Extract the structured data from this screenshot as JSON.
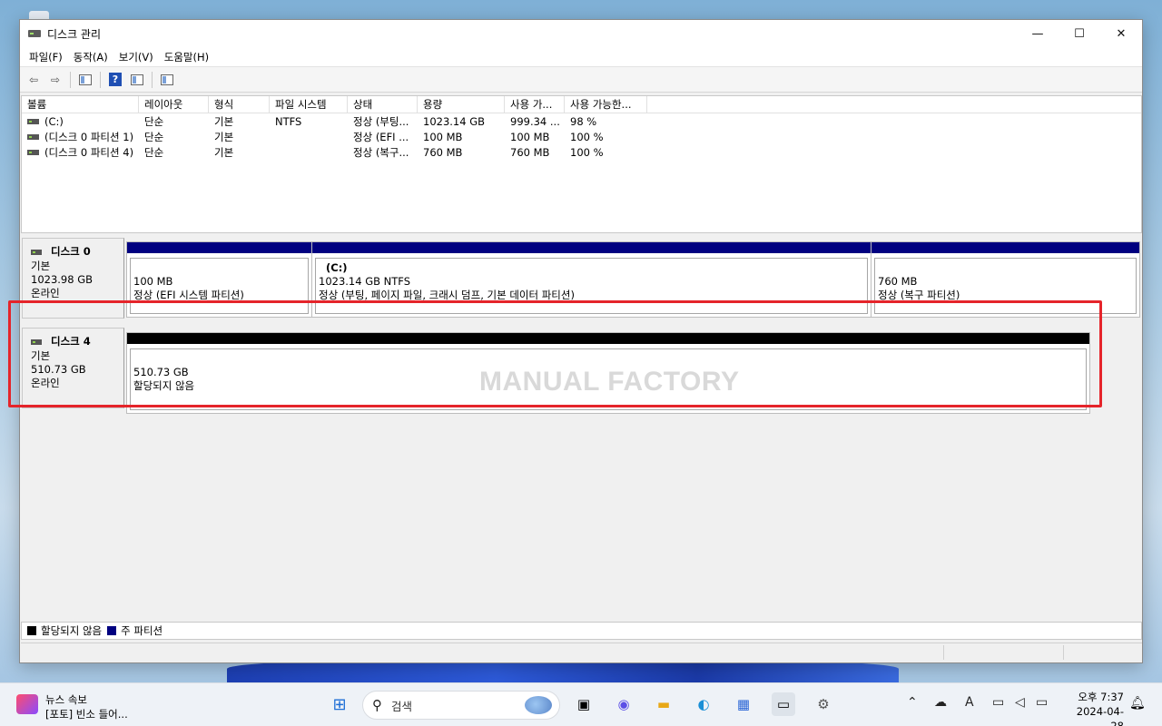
{
  "window": {
    "title": "디스크 관리",
    "controls": {
      "minimize": "—",
      "maximize": "☐",
      "close": "✕"
    }
  },
  "menu": [
    "파일(F)",
    "동작(A)",
    "보기(V)",
    "도움말(H)"
  ],
  "volume_list": {
    "columns": [
      "볼륨",
      "레이아웃",
      "형식",
      "파일 시스템",
      "상태",
      "용량",
      "사용 가...",
      "사용 가능한..."
    ],
    "rows": [
      [
        "(C:)",
        "단순",
        "기본",
        "NTFS",
        "정상 (부팅...",
        "1023.14 GB",
        "999.34 ...",
        "98 %"
      ],
      [
        "(디스크 0 파티션 1)",
        "단순",
        "기본",
        "",
        "정상 (EFI ...",
        "100 MB",
        "100 MB",
        "100 %"
      ],
      [
        "(디스크 0 파티션 4)",
        "단순",
        "기본",
        "",
        "정상 (복구...",
        "760 MB",
        "760 MB",
        "100 %"
      ]
    ]
  },
  "disks": [
    {
      "name": "디스크 0",
      "type": "기본",
      "size": "1023.98 GB",
      "status": "온라인",
      "partitions": [
        {
          "name": "",
          "size": "100 MB",
          "desc": "정상 (EFI 시스템 파티션)"
        },
        {
          "name": "(C:)",
          "size": "1023.14 GB NTFS",
          "desc": "정상 (부팅, 페이지 파일, 크래시 덤프, 기본 데이터 파티션)"
        },
        {
          "name": "",
          "size": "760 MB",
          "desc": "정상 (복구 파티션)"
        }
      ]
    },
    {
      "name": "디스크 4",
      "type": "기본",
      "size": "510.73 GB",
      "status": "온라인",
      "partitions": [
        {
          "size": "510.73 GB",
          "desc": "할당되지 않음"
        }
      ]
    }
  ],
  "watermark": "MANUAL FACTORY",
  "legend": [
    {
      "label": "할당되지 않음",
      "color": "#000000"
    },
    {
      "label": "주 파티션",
      "color": "#000080"
    }
  ],
  "taskbar": {
    "news_title": "뉴스 속보",
    "news_sub": "[포토] 빈소 들어...",
    "search_placeholder": "검색",
    "clock_time": "오후 7:37",
    "clock_date": "2024-04-28"
  },
  "highlight_color": "#e5242a"
}
